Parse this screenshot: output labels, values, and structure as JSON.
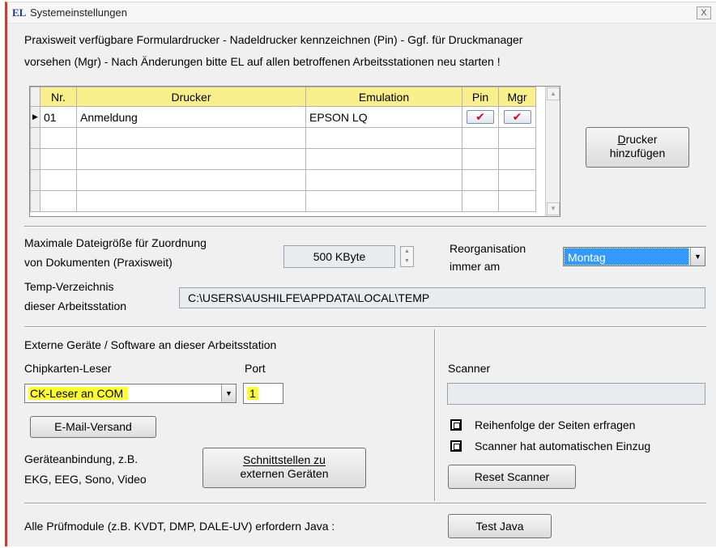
{
  "window": {
    "title": "Systemeinstellungen",
    "icon": "EL",
    "close": "X"
  },
  "intro": {
    "line1": "Praxisweit verfügbare Formulardrucker - Nadeldrucker kennzeichnen (Pin) - Ggf. für Druckmanager",
    "line2": "vorsehen (Mgr) - Nach Änderungen bitte EL auf allen betroffenen Arbeitsstationen neu starten !"
  },
  "printers": {
    "columns": [
      "Nr.",
      "Drucker",
      "Emulation",
      "Pin",
      "Mgr"
    ],
    "rows": [
      {
        "nr": "01",
        "drucker": "Anmeldung",
        "emulation": "EPSON LQ",
        "pin": true,
        "mgr": true
      }
    ],
    "row_marker": "▶",
    "check_glyph": "✔"
  },
  "add_printer_button": {
    "line1": "Drucker",
    "line2": "hinzufügen",
    "accel": "D"
  },
  "max_file_size": {
    "label_line1": "Maximale Dateigröße für Zuordnung",
    "label_line2": "von Dokumenten (Praxisweit)",
    "value": "500 KByte"
  },
  "reorganisation": {
    "label_line1": "Reorganisation",
    "label_line2": "immer am",
    "selected": "Montag"
  },
  "temp_dir": {
    "label_line1": "Temp-Verzeichnis",
    "label_line2": "dieser Arbeitsstation",
    "value": "C:\\USERS\\AUSHILFE\\APPDATA\\LOCAL\\TEMP"
  },
  "external": {
    "heading": "Externe Geräte / Software an dieser Arbeitsstation",
    "chipcard_label": "Chipkarten-Leser",
    "port_label": "Port",
    "chipcard_selected": "CK-Leser an COM",
    "port_value": "1",
    "email_button": "E-Mail-Versand",
    "device_text_line1": "Geräteanbindung, z.B.",
    "device_text_line2": "EKG, EEG, Sono, Video",
    "interfaces_button_line1": "Schnittstellen zu",
    "interfaces_button_line2": "externen Geräten"
  },
  "scanner": {
    "label": "Scanner",
    "value": "",
    "option1": "Reihenfolge der Seiten erfragen",
    "option2": "Scanner hat automatischen Einzug",
    "reset_button": "Reset Scanner"
  },
  "java": {
    "note": "Alle Prüfmodule (z.B. KVDT, DMP, DALE-UV) erfordern Java :",
    "test_button": "Test Java"
  },
  "colors": {
    "header_yellow": "#f9ef8c",
    "highlight_yellow": "#ffff33",
    "selection_blue": "#3399ff",
    "check_red": "#c8102e",
    "window_border": "#d03a2f"
  }
}
